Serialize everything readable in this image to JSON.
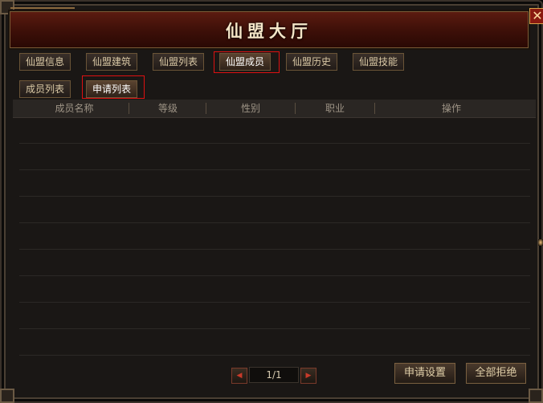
{
  "window": {
    "title": "仙盟大厅",
    "close_glyph": "✕"
  },
  "main_tabs": [
    {
      "label": "仙盟信息",
      "active": false
    },
    {
      "label": "仙盟建筑",
      "active": false
    },
    {
      "label": "仙盟列表",
      "active": false
    },
    {
      "label": "仙盟成员",
      "active": true
    },
    {
      "label": "仙盟历史",
      "active": false
    },
    {
      "label": "仙盟技能",
      "active": false
    }
  ],
  "sub_tabs": [
    {
      "label": "成员列表",
      "active": false
    },
    {
      "label": "申请列表",
      "active": true
    }
  ],
  "table": {
    "columns": [
      "成员名称",
      "等级",
      "性别",
      "职业",
      "操作"
    ],
    "rows": []
  },
  "pager": {
    "prev_glyph": "◀",
    "next_glyph": "▶",
    "page_text": "1/1"
  },
  "actions": {
    "settings_label": "申请设置",
    "reject_all_label": "全部拒绝"
  },
  "colors": {
    "title_bar": "#4a140b",
    "highlight": "#dd1111",
    "panel": "#1a1715"
  }
}
